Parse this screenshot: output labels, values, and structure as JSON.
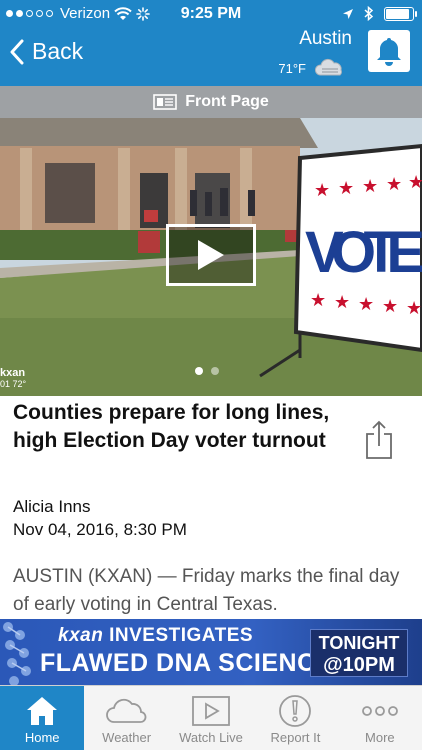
{
  "status_bar": {
    "carrier": "Verizon",
    "time": "9:25 PM",
    "battery_level": 0.9
  },
  "nav": {
    "back_label": "Back",
    "city": "Austin",
    "temperature": "71°F"
  },
  "section": {
    "title": "Front Page"
  },
  "hero": {
    "watermark_brand": "kxan",
    "watermark_sub": "01  72°",
    "sign_text": "VOTE",
    "slides": 2,
    "active_slide": 1
  },
  "article": {
    "headline": "Counties prepare for long lines, high Election Day voter turnout",
    "author": "Alicia Inns",
    "date": "Nov 04, 2016, 8:30 PM",
    "lead": "AUSTIN (KXAN) — Friday marks the final day of early voting in Central Texas."
  },
  "ad": {
    "brand": "kxan",
    "line1": "INVESTIGATES",
    "line2": "FLAWED DNA SCIENCE",
    "tonight": "TONIGHT",
    "time": "@10PM"
  },
  "tabs": [
    {
      "label": "Home",
      "icon": "home-icon",
      "active": true
    },
    {
      "label": "Weather",
      "icon": "cloud-icon",
      "active": false
    },
    {
      "label": "Watch Live",
      "icon": "play-icon",
      "active": false
    },
    {
      "label": "Report It",
      "icon": "alert-icon",
      "active": false
    },
    {
      "label": "More",
      "icon": "more-icon",
      "active": false
    }
  ],
  "colors": {
    "brand_blue": "#1f86c7",
    "section_gray": "#9ea1a4",
    "sign_red": "#c8102e",
    "sign_blue": "#1c3f94"
  }
}
